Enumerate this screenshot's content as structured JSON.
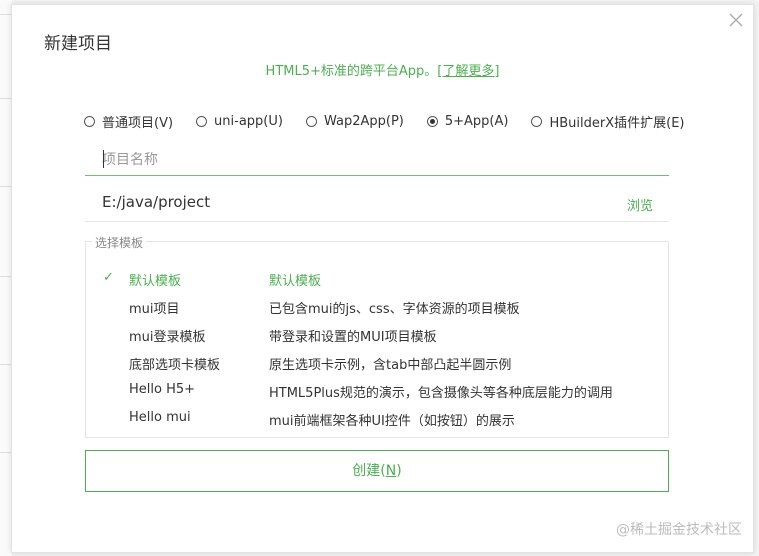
{
  "dialog": {
    "title": "新建项目",
    "subtitle_text": "HTML5+标准的跨平台App。",
    "subtitle_link": "[了解更多]"
  },
  "project_types": [
    {
      "label": "普通项目(V)",
      "checked": false
    },
    {
      "label": "uni-app(U)",
      "checked": false
    },
    {
      "label": "Wap2App(P)",
      "checked": false
    },
    {
      "label": "5+App(A)",
      "checked": true
    },
    {
      "label": "HBuilderX插件扩展(E)",
      "checked": false
    }
  ],
  "name_field": {
    "placeholder": "项目名称",
    "value": ""
  },
  "path_field": {
    "value": "E:/java/project",
    "browse_label": "浏览"
  },
  "templates": {
    "legend": "选择模板",
    "check_glyph": "✓",
    "items": [
      {
        "name": "默认模板",
        "desc": "默认模板",
        "selected": true
      },
      {
        "name": "mui项目",
        "desc": "已包含mui的js、css、字体资源的项目模板",
        "selected": false
      },
      {
        "name": "mui登录模板",
        "desc": "带登录和设置的MUI项目模板",
        "selected": false
      },
      {
        "name": "底部选项卡模板",
        "desc": "原生选项卡示例，含tab中部凸起半圆示例",
        "selected": false
      },
      {
        "name": "Hello H5+",
        "desc": "HTML5Plus规范的演示，包含摄像头等各种底层能力的调用",
        "selected": false
      },
      {
        "name": "Hello mui",
        "desc": "mui前端框架各种UI控件（如按钮）的展示",
        "selected": false
      }
    ]
  },
  "create_button": {
    "label_main": "创建(",
    "label_key": "N",
    "label_end": ")"
  },
  "watermark": "@稀土掘金技术社区",
  "colors": {
    "accent": "#4caf50",
    "border": "#e3e3e3",
    "text": "#333333"
  },
  "icons": {
    "close": "close-icon",
    "check": "check-icon"
  }
}
